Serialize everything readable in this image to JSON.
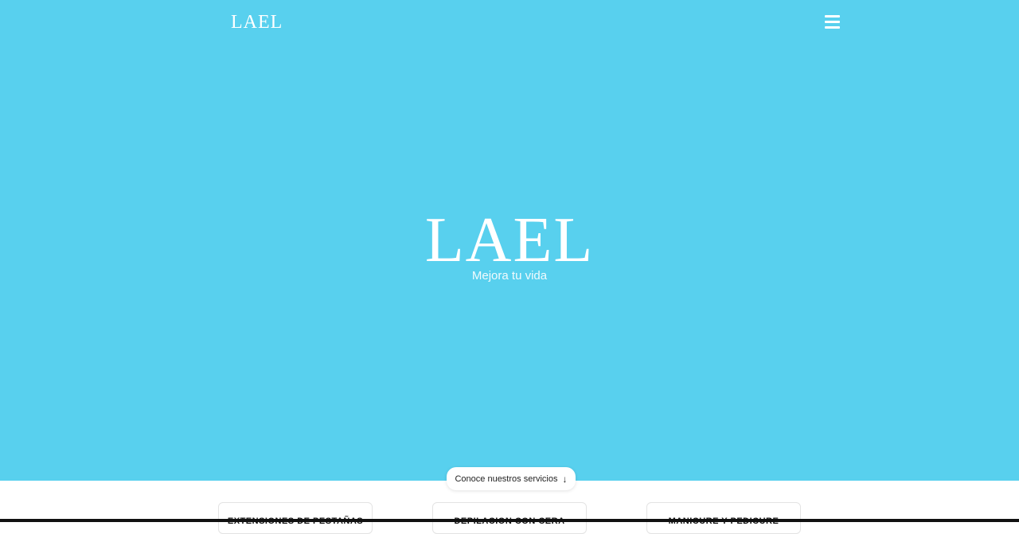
{
  "header": {
    "logo": "LAEL",
    "menu_icon": "hamburger-menu-icon"
  },
  "hero": {
    "title": "LAEL",
    "tagline": "Mejora tu vida",
    "background_color": "#58d0ee",
    "cta_label": "Conoce nuestros servicios",
    "cta_icon": "arrow-down-icon"
  },
  "services": [
    {
      "label": "EXTENSIONES DE PESTAÑAS"
    },
    {
      "label": "DEPILACION CON CERA"
    },
    {
      "label": "MANICURE Y PEDICURE"
    }
  ]
}
